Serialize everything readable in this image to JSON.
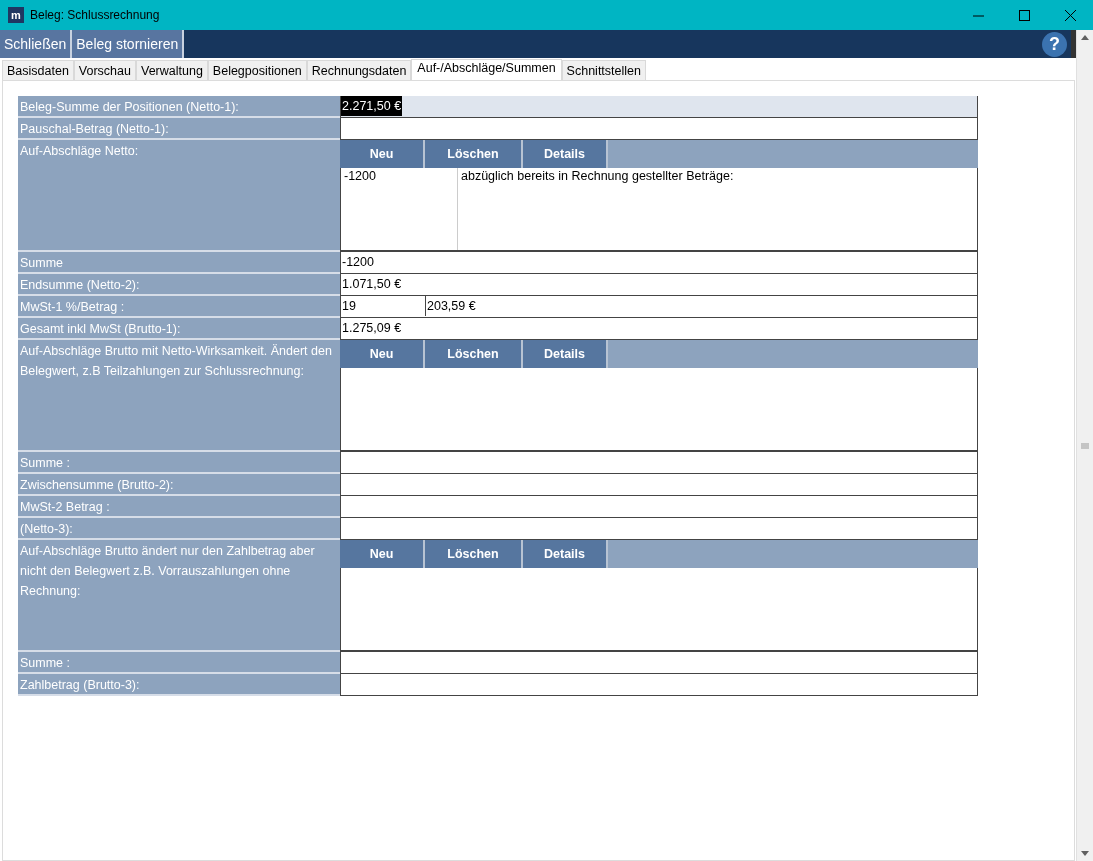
{
  "window": {
    "logo": "m",
    "title": "Beleg: Schlussrechnung"
  },
  "toolbar": {
    "buttons": [
      "Schließen",
      "Beleg stornieren"
    ],
    "help": "?"
  },
  "tabs": [
    {
      "label": "Basisdaten",
      "selected": false
    },
    {
      "label": "Vorschau",
      "selected": false
    },
    {
      "label": "Verwaltung",
      "selected": false
    },
    {
      "label": "Belegpositionen",
      "selected": false
    },
    {
      "label": "Rechnungsdaten",
      "selected": false
    },
    {
      "label": "Auf-/Abschläge/Summen",
      "selected": true
    },
    {
      "label": "Schnittstellen",
      "selected": false
    }
  ],
  "rows": [
    {
      "kind": "field",
      "label": "Beleg-Summe der Positionen (Netto-1):",
      "readonly": true,
      "values": [
        {
          "text": "2.271,50 €",
          "selected": true
        }
      ]
    },
    {
      "kind": "field",
      "label": "Pauschal-Betrag (Netto-1):",
      "readonly": false,
      "values": []
    },
    {
      "kind": "section",
      "label": "Auf-Abschläge Netto:",
      "buttons": [
        "Neu",
        "Löschen",
        "Details"
      ],
      "entries": [
        {
          "amount": "-1200",
          "text": "abzüglich bereits in Rechnung gestellter Beträge:"
        }
      ]
    },
    {
      "kind": "field",
      "label": "Summe",
      "readonly": false,
      "values": [
        {
          "text": "-1200",
          "selected": false
        }
      ]
    },
    {
      "kind": "field",
      "label": "Endsumme (Netto-2):",
      "readonly": false,
      "values": [
        {
          "text": "1.071,50 €",
          "selected": false
        }
      ]
    },
    {
      "kind": "field",
      "label": "MwSt-1 %/Betrag :",
      "readonly": false,
      "values": [
        {
          "text": "19",
          "selected": false
        },
        {
          "text": "203,59 €",
          "selected": false
        }
      ]
    },
    {
      "kind": "field",
      "label": "Gesamt inkl MwSt (Brutto-1):",
      "readonly": false,
      "values": [
        {
          "text": "1.275,09 €",
          "selected": false
        }
      ]
    },
    {
      "kind": "section",
      "label": "Auf-Abschläge Brutto mit Netto-Wirksamkeit. Ändert den Belegwert, z.B Teilzahlungen zur Schlussrechnung:",
      "buttons": [
        "Neu",
        "Löschen",
        "Details"
      ],
      "entries": []
    },
    {
      "kind": "field",
      "label": "Summe :",
      "readonly": false,
      "values": []
    },
    {
      "kind": "field",
      "label": "Zwischensumme (Brutto-2):",
      "readonly": false,
      "values": []
    },
    {
      "kind": "field",
      "label": "MwSt-2 Betrag :",
      "readonly": false,
      "values": []
    },
    {
      "kind": "field",
      "label": "(Netto-3):",
      "readonly": false,
      "values": []
    },
    {
      "kind": "section",
      "label": "Auf-Abschläge Brutto ändert nur den Zahlbetrag aber nicht den Belegwert z.B. Vorrauszahlungen ohne Rechnung:",
      "buttons": [
        "Neu",
        "Löschen",
        "Details"
      ],
      "entries": []
    },
    {
      "kind": "field",
      "label": "Summe :",
      "readonly": false,
      "values": []
    },
    {
      "kind": "field",
      "label": "Zahlbetrag (Brutto-3):",
      "readonly": false,
      "values": []
    }
  ]
}
